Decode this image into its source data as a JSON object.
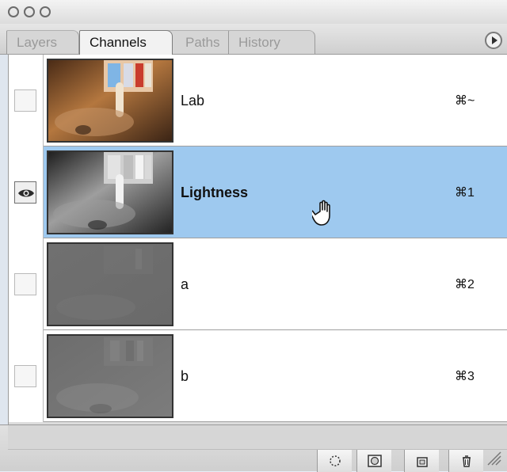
{
  "window": {
    "title": ""
  },
  "tabs": [
    {
      "label": "Layers",
      "active": false
    },
    {
      "label": "Channels",
      "active": true
    },
    {
      "label": "Paths",
      "active": false
    },
    {
      "label": "History",
      "active": false
    }
  ],
  "channels": [
    {
      "name": "Lab",
      "shortcut": "⌘~",
      "visible": false,
      "selected": false,
      "thumb": "color"
    },
    {
      "name": "Lightness",
      "shortcut": "⌘1",
      "visible": true,
      "selected": true,
      "thumb": "lightness"
    },
    {
      "name": "a",
      "shortcut": "⌘2",
      "visible": false,
      "selected": false,
      "thumb": "a"
    },
    {
      "name": "b",
      "shortcut": "⌘3",
      "visible": false,
      "selected": false,
      "thumb": "b"
    }
  ],
  "colors": {
    "selection": "#9ec9ef",
    "panel": "#ffffff",
    "border": "#9a9a9a"
  },
  "icons": {
    "eye": "eye-icon",
    "cursor": "hand-pointer-icon",
    "panel_menu": "panel-menu-arrow-icon",
    "footer": [
      "load-channel-as-selection-icon",
      "save-selection-as-channel-icon",
      "new-channel-icon",
      "delete-channel-icon"
    ]
  }
}
